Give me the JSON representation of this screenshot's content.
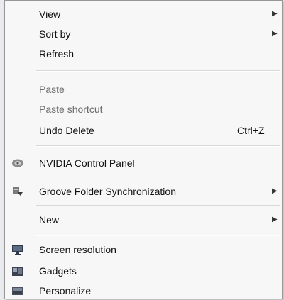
{
  "menu": {
    "view": {
      "label": "View",
      "submenu": true
    },
    "sort_by": {
      "label": "Sort by",
      "submenu": true
    },
    "refresh": {
      "label": "Refresh"
    },
    "paste": {
      "label": "Paste",
      "enabled": false
    },
    "paste_shortcut": {
      "label": "Paste shortcut",
      "enabled": false
    },
    "undo_delete": {
      "label": "Undo Delete",
      "shortcut": "Ctrl+Z"
    },
    "nvidia": {
      "label": "NVIDIA Control Panel",
      "icon": "nvidia-icon"
    },
    "groove": {
      "label": "Groove Folder Synchronization",
      "icon": "groove-sync-icon",
      "submenu": true
    },
    "new": {
      "label": "New",
      "submenu": true
    },
    "screen_resolution": {
      "label": "Screen resolution",
      "icon": "screen-resolution-icon"
    },
    "gadgets": {
      "label": "Gadgets",
      "icon": "gadgets-icon"
    },
    "personalize": {
      "label": "Personalize",
      "icon": "personalize-icon"
    }
  },
  "colors": {
    "menu_background": "#f7f7f7",
    "disabled_text": "#6d6d6d",
    "text": "#111111"
  }
}
